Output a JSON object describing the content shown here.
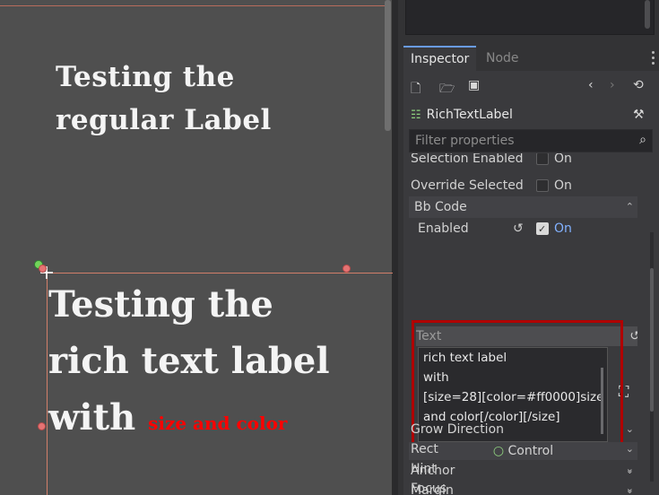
{
  "viewport": {
    "label_line1": "Testing the",
    "label_line2": "regular Label",
    "rich_line1": "Testing the",
    "rich_line2": "rich text label",
    "rich_line3_white": "with",
    "rich_line3_red": "size and color"
  },
  "inspector": {
    "tabs": [
      "Inspector",
      "Node"
    ],
    "toolbar_icons": [
      "new-resource-icon",
      "open-folder-icon",
      "save-icon",
      "history-back-icon",
      "history-forward-icon",
      "object-history-icon"
    ],
    "node_type": "RichTextLabel",
    "filter_placeholder": "Filter properties",
    "properties": {
      "selection_enabled": {
        "label": "Selection Enabled",
        "value": "On",
        "checked": false
      },
      "override_selected": {
        "label": "Override Selected",
        "value": "On",
        "checked": false
      },
      "bbcode_section": "Bb Code",
      "enabled": {
        "label": "Enabled",
        "value": "On",
        "checked": true
      },
      "text_label": "Text",
      "text_lines": [
        "rich text label",
        "with",
        "[size=28][color=#ff0000]size",
        "and color[/color][/size]"
      ],
      "control_section": "Control",
      "groups": [
        "Anchor",
        "Margin",
        "Grow Direction",
        "Rect",
        "Hint",
        "Focus"
      ]
    }
  },
  "colors": {
    "rich_red": "#ff0000",
    "highlight_outline": "#b00000",
    "accent": "#699ce8",
    "on_blue": "#82b1ff"
  }
}
